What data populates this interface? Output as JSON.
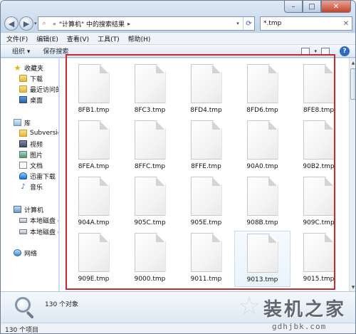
{
  "address": {
    "breadcrumb_sep": "«",
    "location": "\"计算机\" 中的搜索结果",
    "arrow": "▸"
  },
  "search": {
    "value": "*.tmp"
  },
  "menubar": {
    "items": [
      "文件(F)",
      "编辑(E)",
      "查看(V)",
      "工具(T)",
      "帮助(H)"
    ]
  },
  "toolbar": {
    "organize": "组织 ▾",
    "save_search": "保存搜索"
  },
  "navpane": {
    "favorites": "收藏夹",
    "downloads": "下载",
    "recent": "最近访问的",
    "desktop": "桌面",
    "libraries": "库",
    "subversion": "Subversion",
    "videos": "视频",
    "pictures": "图片",
    "documents": "文档",
    "thunder": "迅雷下载",
    "music": "音乐",
    "computer": "计算机",
    "drive_c": "本地磁盘 (C",
    "drive_d": "本地磁盘 (D",
    "network": "网络"
  },
  "files": [
    "8FB1.tmp",
    "8FC3.tmp",
    "8FD4.tmp",
    "8FD6.tmp",
    "8FE8.tmp",
    "8FEA.tmp",
    "8FFC.tmp",
    "8FFE.tmp",
    "90A0.tmp",
    "90B2.tmp",
    "904A.tmp",
    "905C.tmp",
    "905E.tmp",
    "908B.tmp",
    "909C.tmp",
    "909E.tmp",
    "9000.tmp",
    "9011.tmp",
    "9013.tmp",
    "9015.tmp"
  ],
  "details": {
    "count_text": "130 个对象"
  },
  "statusbar": {
    "text": "130 个项目"
  },
  "watermark": {
    "brand": "装机之家",
    "url": "gdhjbk.com"
  },
  "colors": {
    "highlight_box": "#c8282f",
    "window_frame": "#cfdceb"
  }
}
